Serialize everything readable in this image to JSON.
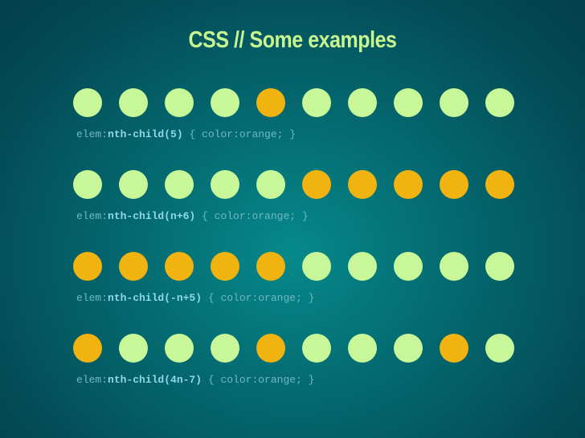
{
  "title": "CSS // Some examples",
  "colors": {
    "highlight": "#f0b30f",
    "normal": "#c8f799",
    "title": "#c8f58f",
    "code": "#6fb8c4",
    "selector": "#8fd8e8"
  },
  "examples": [
    {
      "prefix": "elem:",
      "selector": "nth-child(5)",
      "rule": " { color:orange; }",
      "dots": [
        false,
        false,
        false,
        false,
        true,
        false,
        false,
        false,
        false,
        false
      ]
    },
    {
      "prefix": "elem:",
      "selector": "nth-child(n+6)",
      "rule": " { color:orange; }",
      "dots": [
        false,
        false,
        false,
        false,
        false,
        true,
        true,
        true,
        true,
        true
      ]
    },
    {
      "prefix": "elem:",
      "selector": "nth-child(-n+5)",
      "rule": " { color:orange; }",
      "dots": [
        true,
        true,
        true,
        true,
        true,
        false,
        false,
        false,
        false,
        false
      ]
    },
    {
      "prefix": "elem:",
      "selector": "nth-child(4n-7)",
      "rule": " { color:orange; }",
      "dots": [
        true,
        false,
        false,
        false,
        true,
        false,
        false,
        false,
        true,
        false
      ]
    }
  ]
}
